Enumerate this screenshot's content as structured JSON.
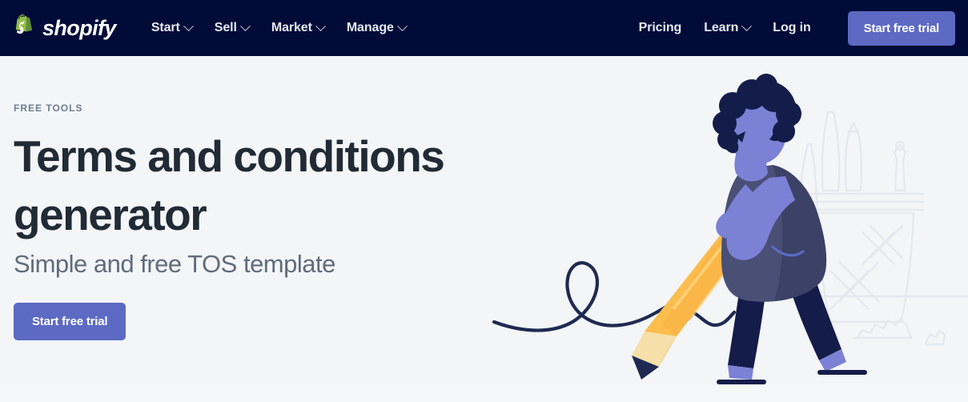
{
  "header": {
    "logo": {
      "name": "shopify-logo",
      "wordmark": "shopify",
      "bag_color": "#95bf47"
    },
    "background_color": "#000b38",
    "nav_left": [
      {
        "label": "Start",
        "has_dropdown": true
      },
      {
        "label": "Sell",
        "has_dropdown": true
      },
      {
        "label": "Market",
        "has_dropdown": true
      },
      {
        "label": "Manage",
        "has_dropdown": true
      }
    ],
    "nav_right": [
      {
        "label": "Pricing",
        "has_dropdown": false
      },
      {
        "label": "Learn",
        "has_dropdown": true
      },
      {
        "label": "Log in",
        "has_dropdown": false
      }
    ],
    "cta_label": "Start free trial",
    "cta_color": "#5c6ac4"
  },
  "hero": {
    "eyebrow": "FREE TOOLS",
    "headline": "Terms and conditions generator",
    "subhead": "Simple and free TOS template",
    "cta_label": "Start free trial",
    "background_color": "#f4f5f7",
    "headline_color": "#212b36",
    "subhead_color": "#5f6c7c",
    "eyebrow_color": "#6d7d91"
  },
  "illustration": {
    "name": "person-drawing-with-giant-pencil",
    "pencil_body_color": "#fbbe4e",
    "pencil_shade_color": "#f9a83c",
    "pencil_wood_color": "#f6dfa8",
    "pencil_tip_color": "#1f2a52",
    "skin_color": "#7b81d4",
    "hair_color": "#141d4a",
    "coat_color": "#4a4f76",
    "coat_shade_color": "#3c4166",
    "legs_color": "#141d4a",
    "shoe_color": "#7b81d4",
    "squiggle_color": "#1f2a52",
    "sketch_color": "#e4e8ef"
  }
}
